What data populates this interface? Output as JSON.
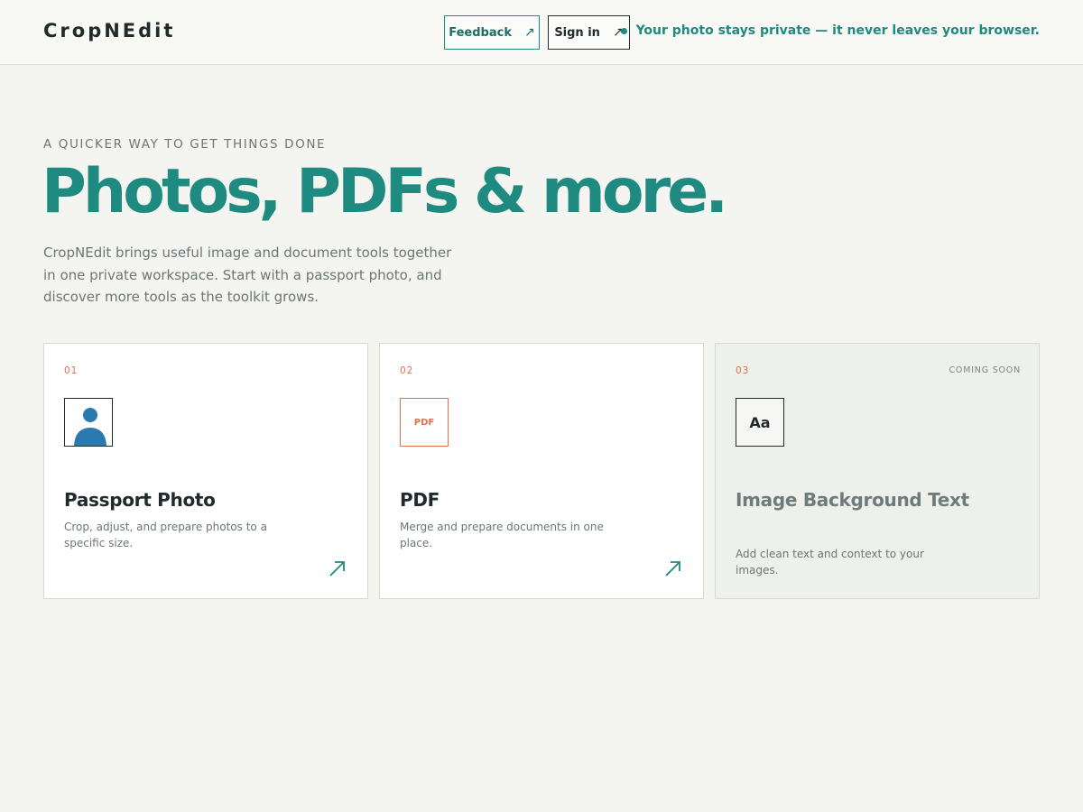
{
  "header": {
    "logo": "CropNEdit",
    "feedback_label": "Feedback",
    "signin_label": "Sign in",
    "privacy_text": "Your photo stays private — it never leaves your browser."
  },
  "hero": {
    "eyebrow": "A QUICKER WAY TO GET THINGS DONE",
    "headline": "Photos, PDFs & more.",
    "intro": "CropNEdit brings useful image and document tools together in one private workspace. Start with a passport photo, and discover more tools as the toolkit grows."
  },
  "tools": [
    {
      "number": "01",
      "title": "Passport Photo",
      "description": "Crop, adjust, and prepare photos to a specific size.",
      "icon": "person-icon"
    },
    {
      "number": "02",
      "title": "PDF",
      "description": "Merge and prepare documents in one place.",
      "icon": "pdf-icon",
      "icon_text": "PDF"
    },
    {
      "number": "03",
      "title": "Image Background Text",
      "description": "Add clean text and context to your images.",
      "icon": "text-icon",
      "icon_text": "Aa",
      "badge": "COMING SOON"
    }
  ],
  "colors": {
    "accent": "#1e8a80",
    "secondary": "#e0714f",
    "background": "#f4f4f0",
    "person_icon": "#2a7ab0"
  }
}
